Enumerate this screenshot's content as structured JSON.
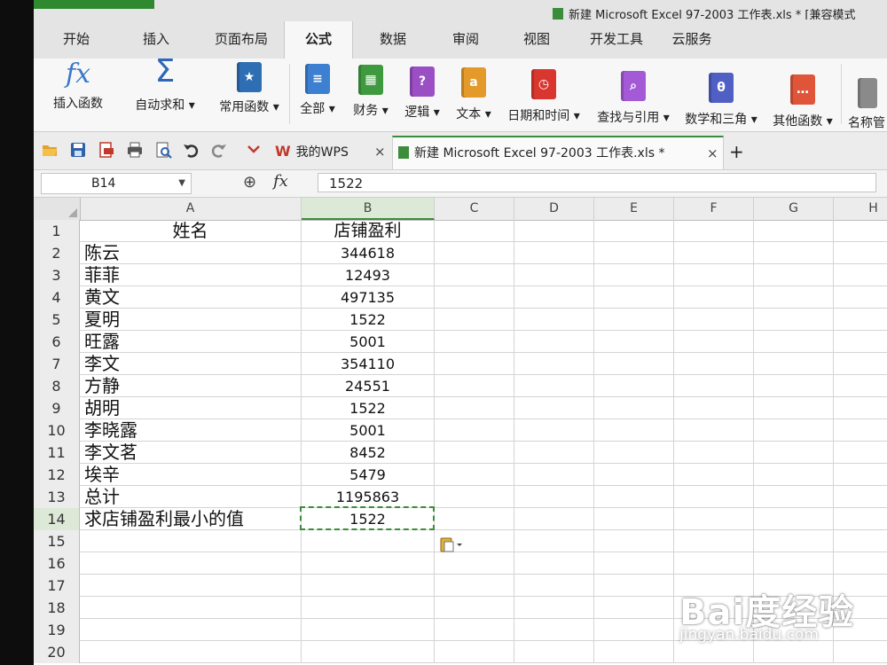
{
  "window": {
    "title": "新建 Microsoft Excel 97-2003 工作表.xls * [兼容模式"
  },
  "menu_tabs": [
    "开始",
    "插入",
    "页面布局",
    "公式",
    "数据",
    "审阅",
    "视图",
    "开发工具",
    "云服务"
  ],
  "active_menu_tab": "公式",
  "ribbon": {
    "insert_function": "插入函数",
    "autosum": "自动求和",
    "common_functions": "常用函数",
    "all": "全部",
    "financial": "财务",
    "logical": "逻辑",
    "text": "文本",
    "date_time": "日期和时间",
    "lookup_reference": "查找与引用",
    "math_trig": "数学和三角",
    "other_functions": "其他函数",
    "name_manager": "名称管"
  },
  "doc_tabs": [
    {
      "label": "我的WPS",
      "close": "×"
    },
    {
      "label": "新建 Microsoft Excel 97-2003 工作表.xls *",
      "close": "×"
    }
  ],
  "new_tab": "+",
  "formula_bar": {
    "name_box": "B14",
    "fx": "fx",
    "value": "1522"
  },
  "columns": [
    "A",
    "B",
    "C",
    "D",
    "E",
    "F",
    "G",
    "H"
  ],
  "selected_column": "B",
  "rows": [
    {
      "n": "1",
      "a": "姓名",
      "b": "店铺盈利"
    },
    {
      "n": "2",
      "a": "陈云",
      "b": "344618"
    },
    {
      "n": "3",
      "a": "菲菲",
      "b": "12493"
    },
    {
      "n": "4",
      "a": "黄文",
      "b": "497135"
    },
    {
      "n": "5",
      "a": "夏明",
      "b": "1522"
    },
    {
      "n": "6",
      "a": "旺露",
      "b": "5001"
    },
    {
      "n": "7",
      "a": "李文",
      "b": "354110"
    },
    {
      "n": "8",
      "a": "方静",
      "b": "24551"
    },
    {
      "n": "9",
      "a": "胡明",
      "b": "1522"
    },
    {
      "n": "10",
      "a": "李晓露",
      "b": "5001"
    },
    {
      "n": "11",
      "a": "李文茗",
      "b": "8452"
    },
    {
      "n": "12",
      "a": "埃辛",
      "b": "5479"
    },
    {
      "n": "13",
      "a": "总计",
      "b": "1195863"
    },
    {
      "n": "14",
      "a": "求店铺盈利最小的值",
      "b": "1522"
    },
    {
      "n": "15",
      "a": "",
      "b": ""
    },
    {
      "n": "16",
      "a": "",
      "b": ""
    },
    {
      "n": "17",
      "a": "",
      "b": ""
    },
    {
      "n": "18",
      "a": "",
      "b": ""
    },
    {
      "n": "19",
      "a": "",
      "b": ""
    },
    {
      "n": "20",
      "a": "",
      "b": ""
    }
  ],
  "selected_row": "14",
  "colors": {
    "accent_green": "#3b8c3b",
    "selection_fill": "#dde9d7"
  },
  "watermark": {
    "brand": "Bai度经验",
    "url": "jingyan.baidu.com"
  }
}
